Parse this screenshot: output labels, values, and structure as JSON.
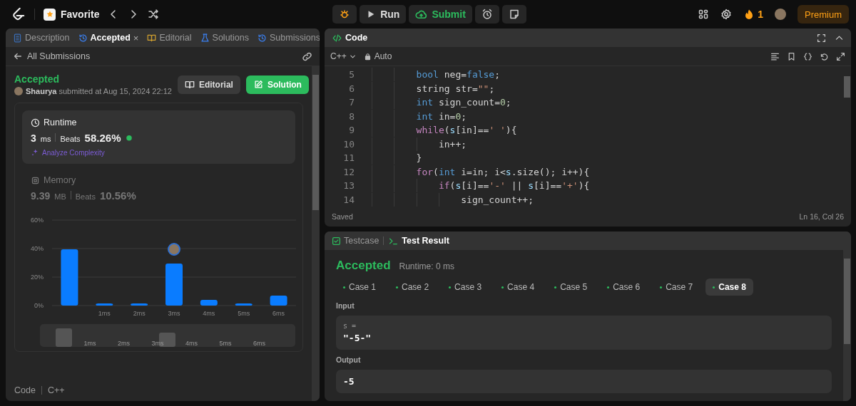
{
  "topbar": {
    "favorite": "Favorite",
    "run": "Run",
    "submit": "Submit",
    "streak": "1",
    "premium": "Premium"
  },
  "left_panel": {
    "tabs": [
      {
        "label": "Description",
        "kind": "document",
        "selected": false
      },
      {
        "label": "Accepted",
        "kind": "history",
        "selected": true,
        "close_label": "×"
      },
      {
        "label": "Editorial",
        "kind": "book",
        "selected": false
      },
      {
        "label": "Solutions",
        "kind": "flask",
        "selected": false
      },
      {
        "label": "Submissions",
        "kind": "history",
        "selected": false
      }
    ],
    "back_link": "All Submissions",
    "status": "Accepted",
    "user": "Shaurya",
    "submitted": "submitted at Aug 15, 2024 22:12",
    "buttons": [
      {
        "label": "Editorial",
        "kind": "secondary"
      },
      {
        "label": "Solution",
        "kind": "primary"
      }
    ],
    "metrics": [
      {
        "title": "Runtime",
        "kind": "clock",
        "value": "3",
        "unit": "ms",
        "beats_label": "Beats",
        "beats": "58.26%",
        "action": "Analyze Complexity",
        "selected": true
      },
      {
        "title": "Memory",
        "kind": "chip",
        "value": "9.39",
        "unit": "MB",
        "beats_label": "Beats",
        "beats": "10.56%",
        "selected": false
      }
    ],
    "chart_data": {
      "type": "bar",
      "x": [
        0,
        1,
        2,
        3,
        4,
        5,
        6
      ],
      "xlim": [
        -0.5,
        6.5
      ],
      "values": [
        39.5,
        1.5,
        1.5,
        29.5,
        4,
        1.5,
        7
      ],
      "ylim": [
        0,
        60
      ],
      "yticks": [
        {
          "value": 0,
          "label": "0%"
        },
        {
          "value": 20,
          "label": "20%"
        },
        {
          "value": 40,
          "label": "40%"
        },
        {
          "value": 60,
          "label": "60%"
        }
      ],
      "xticks": [
        {
          "value": 1,
          "label": "1ms"
        },
        {
          "value": 2,
          "label": "2ms"
        },
        {
          "value": 3,
          "label": "3ms"
        },
        {
          "value": 4,
          "label": "4ms"
        },
        {
          "value": 5,
          "label": "5ms"
        },
        {
          "value": 6,
          "label": "6ms"
        }
      ]
    },
    "navigator_labels": [
      "1ms",
      "2ms",
      "3ms",
      "4ms",
      "5ms",
      "6ms"
    ],
    "code_label": "Code",
    "language": "C++"
  },
  "editor": {
    "title": "Code",
    "language": "C++",
    "mode": "Auto",
    "lines": [
      {
        "number": "5",
        "tokens": [
          {
            "text": "        bool",
            "kind": "keyword"
          },
          {
            "text": " neg=",
            "kind": "plain"
          },
          {
            "text": "false",
            "kind": "keyword"
          },
          {
            "text": ";",
            "kind": "plain"
          }
        ]
      },
      {
        "number": "6",
        "tokens": [
          {
            "text": "        string str=",
            "kind": "plain"
          },
          {
            "text": "\"\"",
            "kind": "string"
          },
          {
            "text": ";",
            "kind": "plain"
          }
        ]
      },
      {
        "number": "7",
        "tokens": [
          {
            "text": "        int",
            "kind": "keyword"
          },
          {
            "text": " sign_count=",
            "kind": "plain"
          },
          {
            "text": "0",
            "kind": "number"
          },
          {
            "text": ";",
            "kind": "plain"
          }
        ]
      },
      {
        "number": "8",
        "tokens": [
          {
            "text": "        int",
            "kind": "keyword"
          },
          {
            "text": " in=",
            "kind": "plain"
          },
          {
            "text": "0",
            "kind": "number"
          },
          {
            "text": ";",
            "kind": "plain"
          }
        ]
      },
      {
        "number": "9",
        "tokens": [
          {
            "text": "        while",
            "kind": "control"
          },
          {
            "text": "(",
            "kind": "plain"
          },
          {
            "text": "s",
            "kind": "variable"
          },
          {
            "text": "[in]==",
            "kind": "plain"
          },
          {
            "text": "' '",
            "kind": "string"
          },
          {
            "text": "){",
            "kind": "plain"
          }
        ]
      },
      {
        "number": "10",
        "tokens": [
          {
            "text": "            in++;",
            "kind": "plain"
          }
        ]
      },
      {
        "number": "11",
        "tokens": [
          {
            "text": "        }",
            "kind": "plain"
          }
        ]
      },
      {
        "number": "12",
        "tokens": [
          {
            "text": "        for",
            "kind": "control"
          },
          {
            "text": "(",
            "kind": "plain"
          },
          {
            "text": "int",
            "kind": "keyword"
          },
          {
            "text": " i=in; i<",
            "kind": "plain"
          },
          {
            "text": "s",
            "kind": "variable"
          },
          {
            "text": ".size(); i++){",
            "kind": "plain"
          }
        ]
      },
      {
        "number": "13",
        "tokens": [
          {
            "text": "            if",
            "kind": "control"
          },
          {
            "text": "(",
            "kind": "plain"
          },
          {
            "text": "s",
            "kind": "variable"
          },
          {
            "text": "[i]==",
            "kind": "plain"
          },
          {
            "text": "'-'",
            "kind": "string"
          },
          {
            "text": " || ",
            "kind": "plain"
          },
          {
            "text": "s",
            "kind": "variable"
          },
          {
            "text": "[i]==",
            "kind": "plain"
          },
          {
            "text": "'+'",
            "kind": "string"
          },
          {
            "text": "){",
            "kind": "plain"
          }
        ]
      },
      {
        "number": "14",
        "tokens": [
          {
            "text": "                sign_count++;",
            "kind": "plain"
          }
        ]
      }
    ],
    "status": "Saved",
    "cursor": "Ln 16, Col 26"
  },
  "results": {
    "tabs": [
      {
        "label": "Testcase",
        "kind": "check",
        "selected": false
      },
      {
        "label": "Test Result",
        "kind": "terminal",
        "selected": true
      }
    ],
    "status": "Accepted",
    "runtime": "Runtime: 0 ms",
    "cases": [
      {
        "label": "Case 1",
        "selected": false
      },
      {
        "label": "Case 2",
        "selected": false
      },
      {
        "label": "Case 3",
        "selected": false
      },
      {
        "label": "Case 4",
        "selected": false
      },
      {
        "label": "Case 5",
        "selected": false
      },
      {
        "label": "Case 6",
        "selected": false
      },
      {
        "label": "Case 7",
        "selected": false
      },
      {
        "label": "Case 8",
        "selected": true
      }
    ],
    "input_label": "Input",
    "input_var": "s =",
    "input_value": "\"-5-\"",
    "output_label": "Output",
    "output_value": "-5"
  }
}
